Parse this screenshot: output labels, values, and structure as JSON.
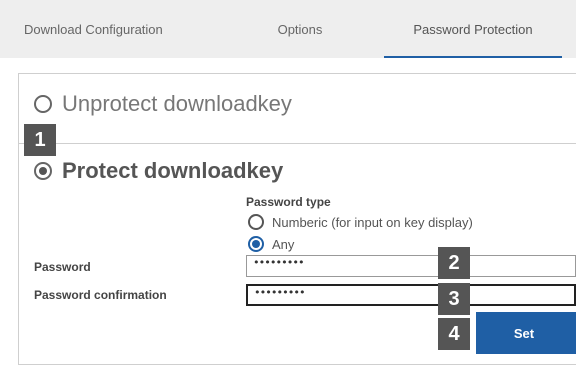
{
  "tabs": [
    {
      "label": "Download Configuration"
    },
    {
      "label": "Options"
    },
    {
      "label": "Password Protection"
    }
  ],
  "active_tab": "Password Protection",
  "protection": {
    "unprotect_label": "Unprotect downloadkey",
    "protect_label": "Protect downloadkey",
    "selected": "protect"
  },
  "password_type": {
    "label": "Password type",
    "options": [
      {
        "label": "Numberic (for input on key display)"
      },
      {
        "label": "Any"
      }
    ],
    "selected": "Any"
  },
  "fields": {
    "password_label": "Password",
    "password_value": "•••••••••",
    "confirm_label": "Password confirmation",
    "confirm_value": "•••••••••"
  },
  "set_button": "Set",
  "badges": [
    "1",
    "2",
    "3",
    "4"
  ],
  "colors": {
    "accent": "#1f5fa5",
    "badge": "#555555",
    "tabbar_bg": "#eeeeee"
  }
}
